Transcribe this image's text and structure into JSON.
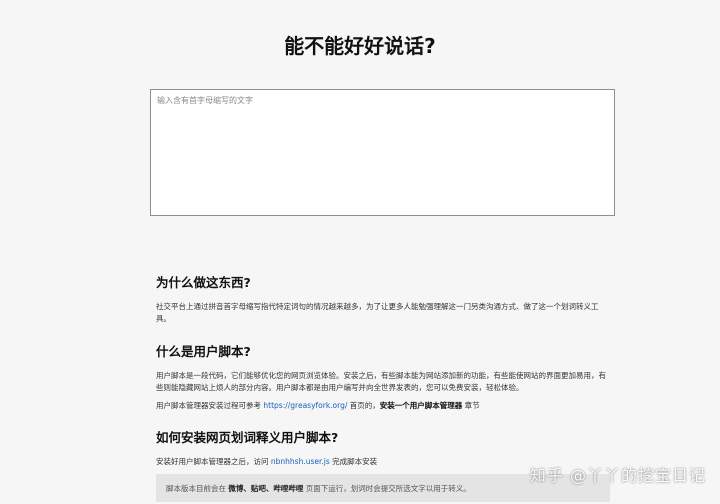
{
  "title": "能不能好好说话?",
  "input": {
    "placeholder": "输入含有首字母缩写的文字"
  },
  "sections": [
    {
      "heading": "为什么做这东西?",
      "p1": "社交平台上通过拼音首字母缩写指代特定词句的情况越来越多，为了让更多人能勉强理解这一门另类沟通方式、做了这一个划词转义工具。"
    },
    {
      "heading": "什么是用户脚本?",
      "p1": "用户脚本是一段代码，它们能够优化您的网页浏览体验。安装之后，有些脚本能为网站添加新的功能，有些能使网站的界面更加易用，有些则能隐藏网站上烦人的部分内容。用户脚本都是由用户编写并向全世界发表的，您可以免费安装，轻松体验。",
      "p2_pre": "用户脚本管理器安装过程可参考",
      "p2_link": "https://greasyfork.org/",
      "p2_mid": "首页的，",
      "p2_bold": "安装一个用户脚本管理器",
      "p2_post": "章节"
    },
    {
      "heading": "如何安装网页划词释义用户脚本?",
      "p1_pre": "安装好用户脚本管理器之后，访问",
      "p1_link": "nbnhhsh.user.js",
      "p1_post": "完成脚本安装"
    }
  ],
  "notice": {
    "pre": "脚本版本目前会在",
    "sites": "微博、贴吧、哔哩哔哩",
    "post": "页面下运行，划词时会提交所选文字以用于转义。"
  },
  "watermark": "知乎 @丫丫的挖宝日记"
}
